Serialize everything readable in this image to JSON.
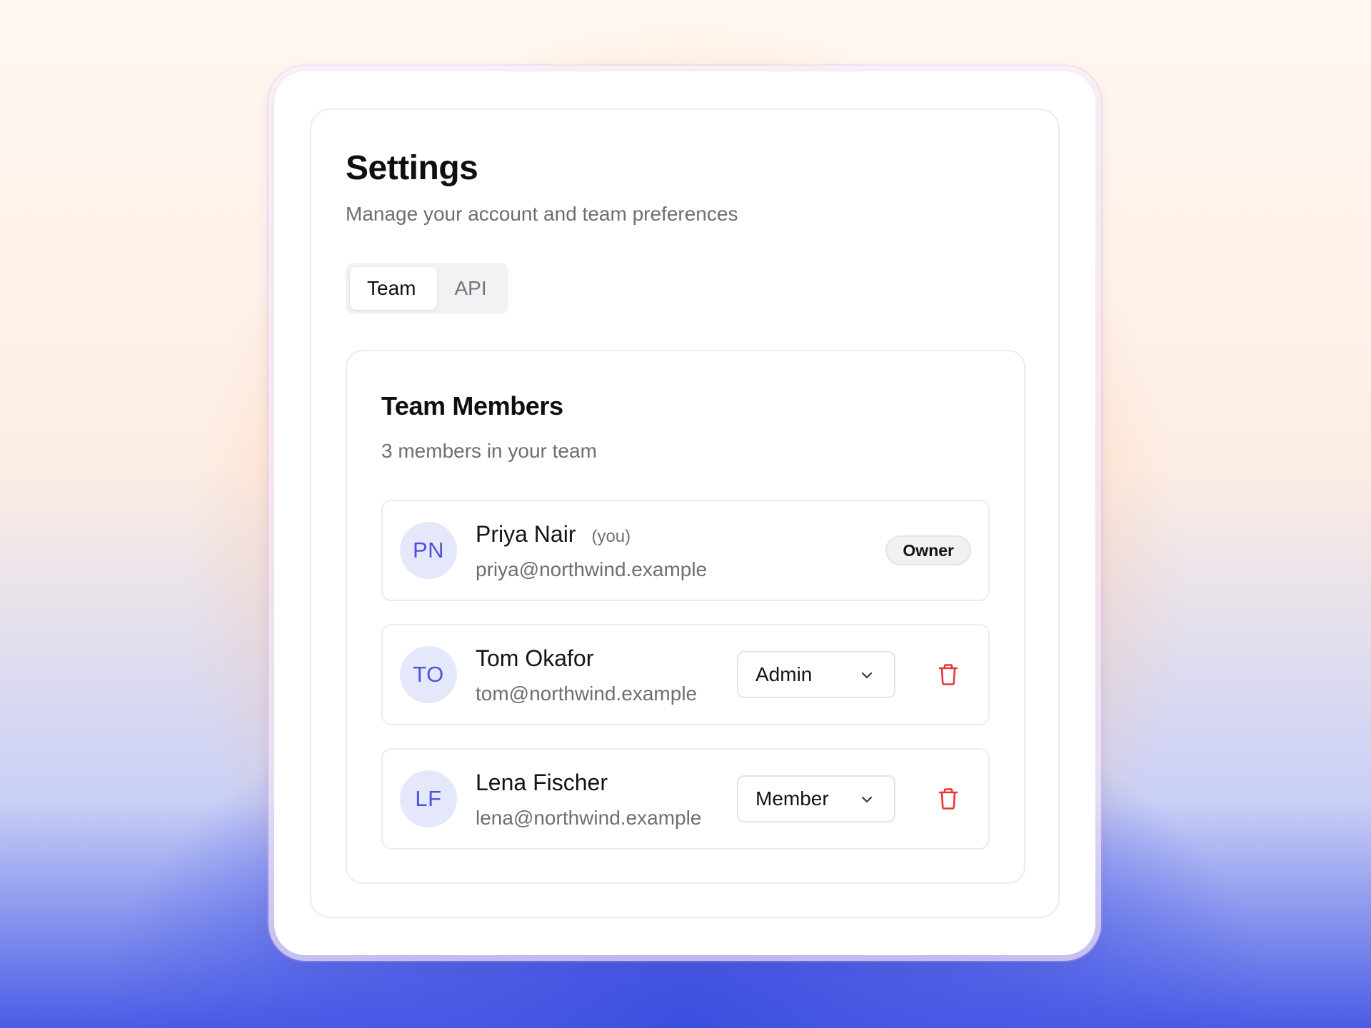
{
  "page": {
    "title": "Settings",
    "subtitle": "Manage your account and team preferences"
  },
  "tabs": [
    {
      "label": "Team",
      "active": true
    },
    {
      "label": "API",
      "active": false
    }
  ],
  "team": {
    "title": "Team Members",
    "count_text": "3 members in your team",
    "members": [
      {
        "initials": "PN",
        "name": "Priya Nair",
        "you_label": "(you)",
        "email": "priya@northwind.example",
        "role": "Owner",
        "role_editable": false
      },
      {
        "initials": "TO",
        "name": "Tom Okafor",
        "email": "tom@northwind.example",
        "role": "Admin",
        "role_editable": true
      },
      {
        "initials": "LF",
        "name": "Lena Fischer",
        "email": "lena@northwind.example",
        "role": "Member",
        "role_editable": true
      }
    ]
  },
  "icons": {
    "chevron": "chevron-down-icon",
    "delete": "trash-icon"
  },
  "colors": {
    "accent": "#4f52d9",
    "avatar_bg": "#e5e8fb",
    "danger": "#e5383b",
    "text_primary": "#141417",
    "text_muted": "#6e6e73"
  }
}
